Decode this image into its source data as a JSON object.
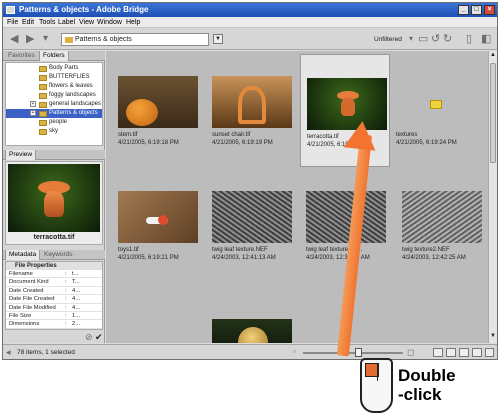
{
  "window": {
    "title": "Patterns & objects - Adobe Bridge",
    "btn_min": "_",
    "btn_max": "□",
    "btn_close": "×"
  },
  "menu": [
    "File",
    "Edit",
    "Tools",
    "Label",
    "View",
    "Window",
    "Help"
  ],
  "toolbar": {
    "path": "Patterns & objects",
    "filter": "Unfiltered"
  },
  "left_panel": {
    "tabs": [
      "Favorites",
      "Folders"
    ],
    "folders": [
      "Body Parts",
      "BUTTERFLIES",
      "flowers & leaves",
      "foggy landscapes",
      "general landscapes",
      "Patterns & objects",
      "people",
      "sky"
    ],
    "preview_tab": "Preview",
    "preview_caption": "terracotta.tif",
    "meta_tabs": [
      "Metadata",
      "Keywords"
    ],
    "meta_header": "File Properties",
    "meta_rows": [
      {
        "key": "Filename",
        "colon": ":",
        "value": "t..."
      },
      {
        "key": "Document Kind",
        "colon": ":",
        "value": "T..."
      },
      {
        "key": "Date Created",
        "colon": ":",
        "value": "4..."
      },
      {
        "key": "Date File Created",
        "colon": ":",
        "value": "4..."
      },
      {
        "key": "Date File Modified",
        "colon": ":",
        "value": "4..."
      },
      {
        "key": "File Size",
        "colon": ":",
        "value": "1..."
      },
      {
        "key": "Dimensions",
        "colon": ":",
        "value": "2..."
      },
      {
        "key": "",
        "colon": "",
        "value": "..."
      }
    ]
  },
  "thumbnails": [
    {
      "name": "stem.tif",
      "date": "4/21/2005, 6:19:18 PM"
    },
    {
      "name": "sunset chair.tif",
      "date": "4/21/2005, 6:19:19 PM"
    },
    {
      "name": "terracotta.tif",
      "date": "4/21/2005, 6:19:20 PM"
    },
    {
      "name": "textures",
      "date": "4/21/2005, 6:19:24 PM"
    },
    {
      "name": "toys1.tif",
      "date": "4/21/2005, 6:19:21 PM"
    },
    {
      "name": "twig leaf texture.NEF",
      "date": "4/24/2003, 12:41:13 AM"
    },
    {
      "name": "twig leaf texture2.N...",
      "date": "4/24/2003, 12:35:45 AM"
    },
    {
      "name": "twig texture2.NEF",
      "date": "4/24/2003, 12:42:25 AM"
    }
  ],
  "status": "78 items, 1 selected",
  "callout": {
    "line1": "Double",
    "line2": "-click"
  }
}
